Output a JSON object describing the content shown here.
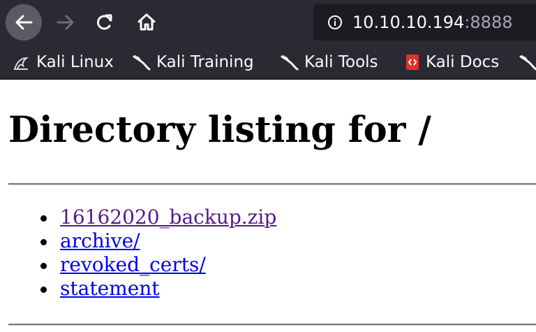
{
  "browser": {
    "url_host": "10.10.10.194",
    "url_port": ":8888",
    "nav": {
      "back_icon": "arrow-left-icon",
      "forward_icon": "arrow-right-icon",
      "reload_icon": "reload-icon",
      "home_icon": "home-icon"
    }
  },
  "bookmarks": [
    {
      "label": "Kali Linux",
      "icon": "kali-dragon-icon"
    },
    {
      "label": "Kali Training",
      "icon": "kali-dragon-icon"
    },
    {
      "label": "Kali Tools",
      "icon": "kali-dragon-icon"
    },
    {
      "label": "Kali Docs",
      "icon": "kali-docs-icon"
    },
    {
      "label": "",
      "icon": "kali-dragon-icon"
    }
  ],
  "page": {
    "heading": "Directory listing for /",
    "files": [
      {
        "name": "16162020_backup.zip",
        "visited": true
      },
      {
        "name": "archive/",
        "visited": false
      },
      {
        "name": "revoked_certs/",
        "visited": false
      },
      {
        "name": "statement",
        "visited": false
      }
    ]
  },
  "colors": {
    "chrome_bg": "#2b2a33",
    "url_bg": "#1c1b22",
    "link": "#0000ee",
    "visited_link": "#551a8b"
  }
}
